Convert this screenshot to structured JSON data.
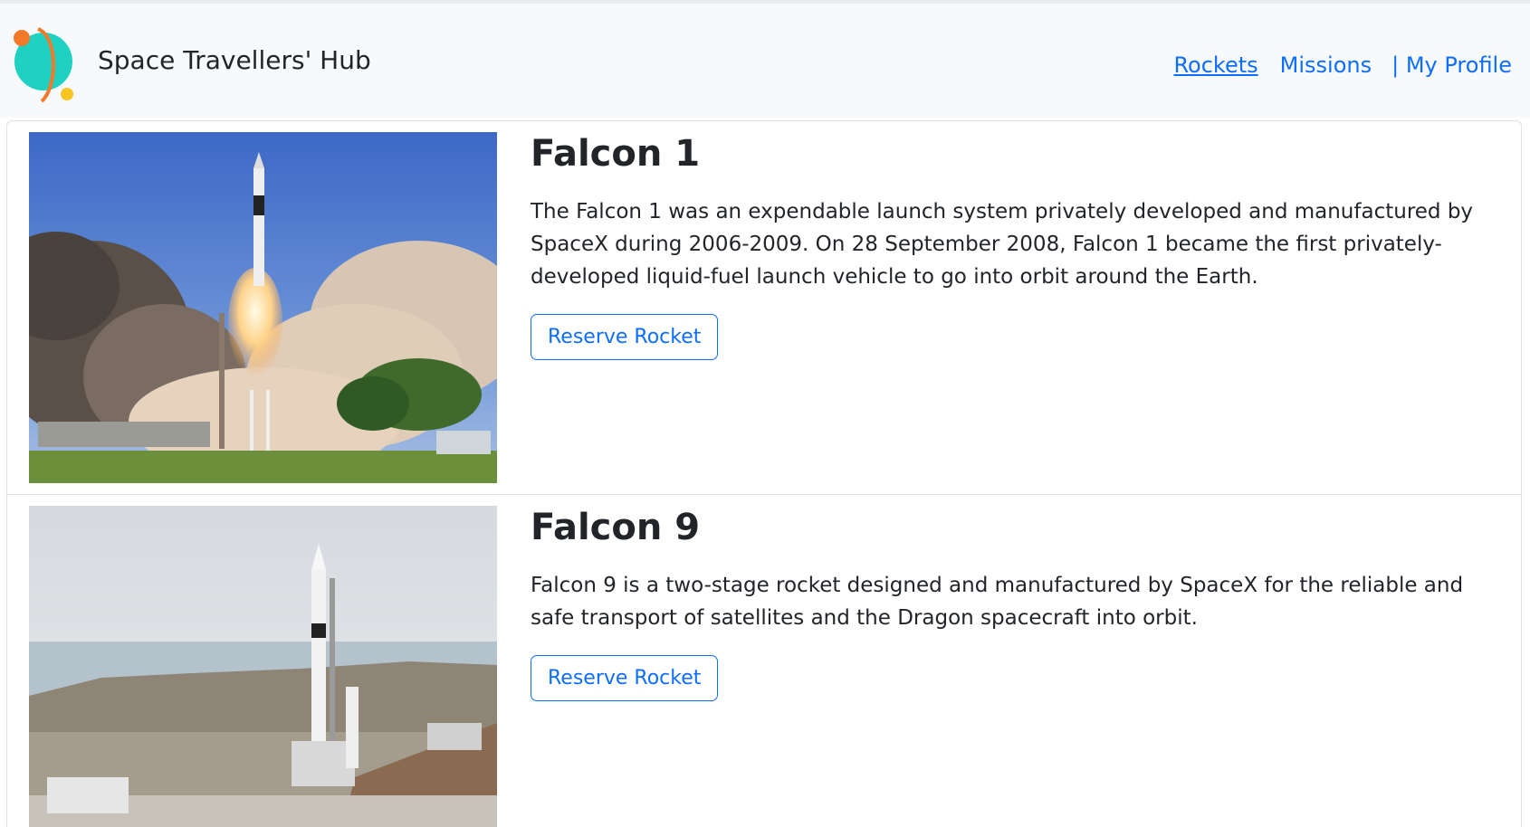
{
  "header": {
    "brand": "Space Travellers' Hub",
    "nav": [
      {
        "label": "Rockets",
        "active": true
      },
      {
        "label": "Missions",
        "active": false
      },
      {
        "label": "| My Profile",
        "active": false
      }
    ]
  },
  "rockets": [
    {
      "name": "Falcon 1",
      "description": "The Falcon 1 was an expendable launch system privately developed and manufactured by SpaceX during 2006-2009. On 28 September 2008, Falcon 1 became the first privately-developed liquid-fuel launch vehicle to go into orbit around the Earth.",
      "button": "Reserve Rocket"
    },
    {
      "name": "Falcon 9",
      "description": "Falcon 9 is a two-stage rocket designed and manufactured by SpaceX for the reliable and safe transport of satellites and the Dragon spacecraft into orbit.",
      "button": "Reserve Rocket"
    }
  ],
  "colors": {
    "link": "#0d6efd",
    "navbar_bg": "#f8f9fa",
    "logo_planet": "#1fd1c1",
    "logo_ring": "#f27a2a"
  }
}
